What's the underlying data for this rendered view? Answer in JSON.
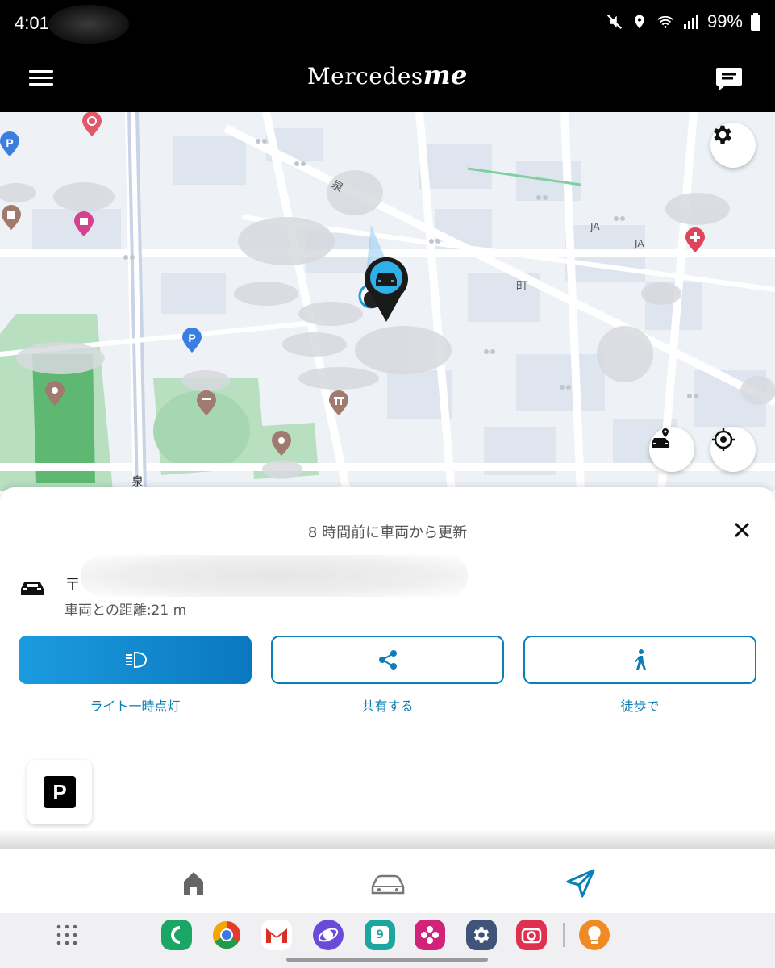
{
  "status_bar": {
    "time": "4:01",
    "battery": "99%",
    "icons": [
      "mute-icon",
      "location-icon",
      "wifi-icon",
      "signal-icon",
      "battery-icon"
    ]
  },
  "app_bar": {
    "brand_main": "Mercedes",
    "brand_me": "me",
    "icons": [
      "hamburger-menu-icon",
      "chat-icon"
    ]
  },
  "map": {
    "labels": [
      "泉",
      "町",
      "JA",
      "JA",
      "泉"
    ],
    "controls": [
      "settings-icon",
      "car-location-icon",
      "my-location-icon"
    ]
  },
  "sheet": {
    "update_text": "8 時間前に車両から更新",
    "address_visible": "〒",
    "distance": "車両との距離:21 m",
    "actions": [
      {
        "label": "ライト一時点灯",
        "icon": "headlight-icon"
      },
      {
        "label": "共有する",
        "icon": "share-icon"
      },
      {
        "label": "徒歩で",
        "icon": "walk-icon"
      }
    ],
    "parking_label": "P"
  },
  "bottom_nav": {
    "items": [
      "home-icon",
      "car-icon",
      "navigate-icon"
    ],
    "active": "navigate-icon"
  },
  "dock": {
    "apps": [
      "apps-grid-icon",
      "phone-app",
      "chrome-app",
      "gmail-app",
      "internet-app",
      "calendar-app",
      "gallery-app",
      "settings-app",
      "camera-app",
      "tips-app"
    ],
    "calendar_day": "9"
  },
  "colors": {
    "accent": "#0a7fb8",
    "primary_button": "#1c9be0",
    "header": "#000000",
    "map_bg": "#eef2f7"
  }
}
